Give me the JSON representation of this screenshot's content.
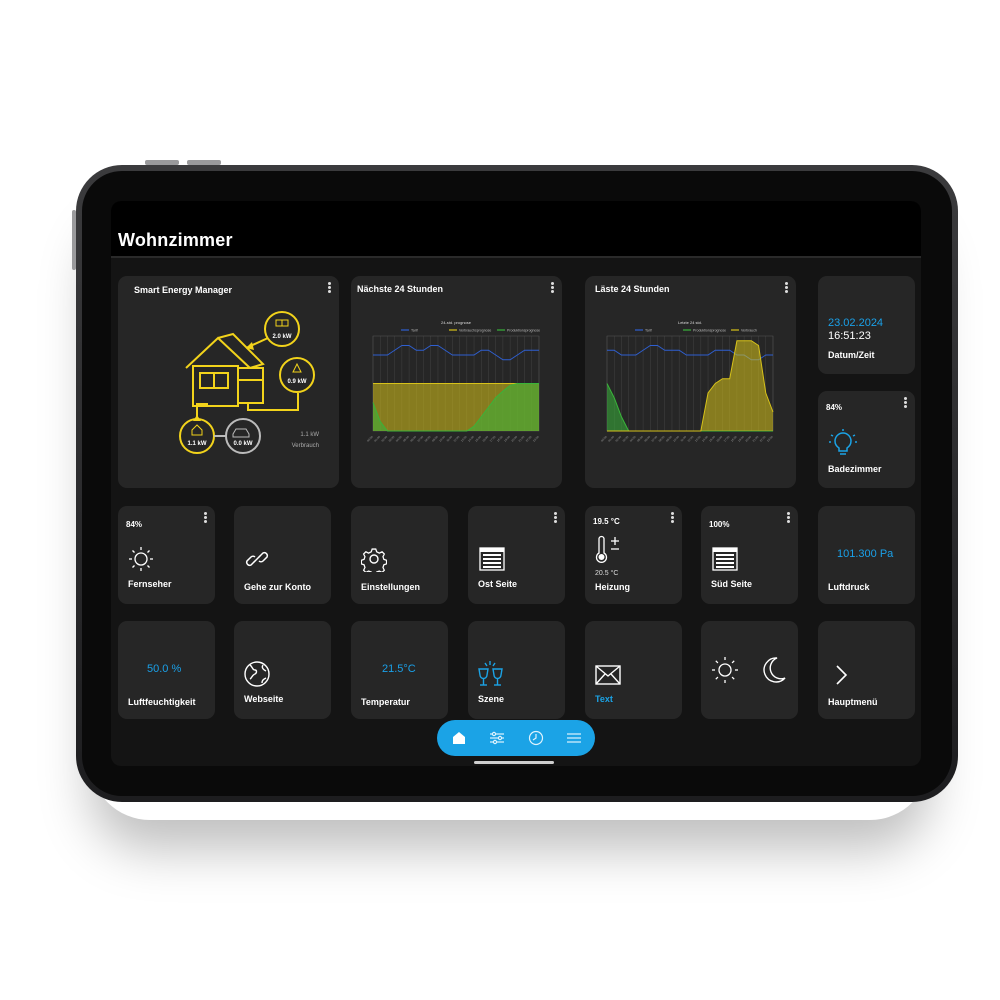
{
  "header": {
    "title": "Wohnzimmer"
  },
  "energy": {
    "title": "Smart Energy Manager",
    "solar": "2.0 kW",
    "grid": "0.9 kW",
    "home": "1.1 kW",
    "car": "0.0 kW",
    "usage_value": "1.1 kW",
    "usage_label": "Verbrauch"
  },
  "next24": {
    "title": "Nächste 24 Stunden",
    "chart_title": "24-std. prognose",
    "legend": [
      "Tarif",
      "Verbrauchsprognose",
      "Produktionsprognose"
    ]
  },
  "last24": {
    "title": "Läste 24 Stunden",
    "chart_title": "Letzte 24 std.",
    "legend": [
      "Tarif",
      "Produktionsprognose",
      "Verbrauch"
    ]
  },
  "datetime": {
    "date": "23.02.2024",
    "time": "16:51:23",
    "label": "Datum/Zeit"
  },
  "bad": {
    "pct": "84%",
    "label": "Badezimmer"
  },
  "fernseher": {
    "pct": "84%",
    "label": "Fernseher"
  },
  "konto": {
    "label": "Gehe zur Konto"
  },
  "einstellungen": {
    "label": "Einstellungen"
  },
  "ost": {
    "label": "Ost Seite"
  },
  "heizung": {
    "current": "19.5 °C",
    "target": "20.5 °C",
    "label": "Heizung"
  },
  "sued": {
    "pct": "100%",
    "label": "Süd Seite"
  },
  "luftdruck": {
    "value": "101.300 Pa",
    "label": "Luftdruck"
  },
  "luftfeuchtigkeit": {
    "value": "50.0 %",
    "label": "Luftfeuchtigkeit"
  },
  "webseite": {
    "label": "Webseite"
  },
  "temperatur": {
    "value": "21.5°C",
    "label": "Temperatur"
  },
  "szene": {
    "label": "Szene"
  },
  "text": {
    "label": "Text"
  },
  "hauptmenu": {
    "label": "Hauptmenü"
  },
  "colors": {
    "accent": "#1ba3e6",
    "energy": "#f2d31b",
    "tile": "#262626"
  },
  "chart_data": [
    {
      "type": "line",
      "title": "24-std. prognose",
      "series": [
        {
          "name": "Tarif",
          "values": [
            0.8,
            0.8,
            0.8,
            0.85,
            0.9,
            0.9,
            0.85,
            0.85,
            0.9,
            0.9,
            0.85,
            0.8,
            0.8,
            0.8,
            0.8,
            0.85,
            0.85,
            0.8,
            0.75,
            0.75,
            0.8,
            0.85,
            0.85,
            0.85
          ]
        },
        {
          "name": "Verbrauchsprognose",
          "values": [
            0.5,
            0.5,
            0.5,
            0.5,
            0.5,
            0.5,
            0.5,
            0.5,
            0.5,
            0.5,
            0.5,
            0.5,
            0.5,
            0.5,
            0.5,
            0.5,
            0.5,
            0.5,
            0.5,
            0.5,
            0.5,
            0.5,
            0.5,
            0.5
          ]
        },
        {
          "name": "Produktionsprognose",
          "values": [
            0.3,
            0.1,
            0,
            0,
            0,
            0,
            0,
            0,
            0,
            0,
            0,
            0,
            0,
            0,
            0.05,
            0.15,
            0.25,
            0.35,
            0.42,
            0.48,
            0.5,
            0.5,
            0.5,
            0.5
          ]
        }
      ]
    },
    {
      "type": "line",
      "title": "Letzte 24 std.",
      "series": [
        {
          "name": "Tarif",
          "values": [
            0.85,
            0.85,
            0.8,
            0.8,
            0.8,
            0.85,
            0.9,
            0.9,
            0.85,
            0.85,
            0.85,
            0.8,
            0.8,
            0.8,
            0.8,
            0.85,
            0.85,
            0.85,
            0.8,
            0.8,
            0.75,
            0.75,
            0.8,
            0.8
          ]
        },
        {
          "name": "Produktionsprognose",
          "values": [
            0.5,
            0.35,
            0.15,
            0,
            0,
            0,
            0,
            0,
            0,
            0,
            0,
            0,
            0,
            0,
            0,
            0,
            0,
            0,
            0,
            0,
            0,
            0,
            0,
            0
          ]
        },
        {
          "name": "Verbrauch",
          "values": [
            0,
            0,
            0,
            0,
            0,
            0,
            0,
            0,
            0,
            0,
            0,
            0,
            0,
            0,
            0.4,
            0.5,
            0.55,
            0.55,
            0.95,
            0.95,
            0.95,
            0.9,
            0.4,
            0.2
          ]
        }
      ]
    }
  ]
}
